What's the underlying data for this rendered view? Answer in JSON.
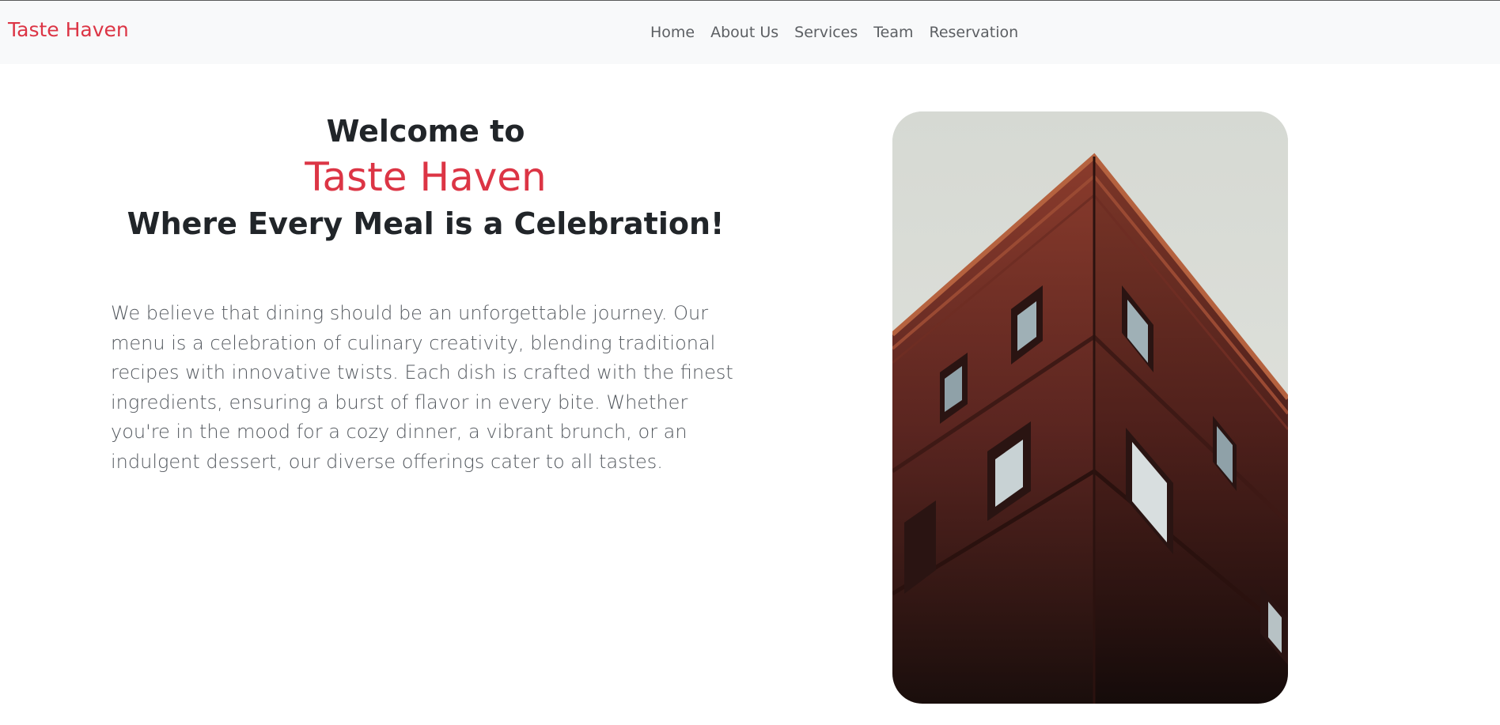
{
  "nav": {
    "brand": "Taste Haven",
    "links": [
      "Home",
      "About Us",
      "Services",
      "Team",
      "Reservation"
    ]
  },
  "hero": {
    "welcome": "Welcome to",
    "brand": "Taste Haven",
    "tagline": "Where Every Meal is a Celebration!",
    "description": "We believe that dining should be an unforgettable journey. Our menu is a celebration of culinary creativity, blending traditional recipes with innovative twists. Each dish is crafted with the finest ingredients, ensuring a burst of flavor in every bite. Whether you're in the mood for a cozy dinner, a vibrant brunch, or an indulgent dessert, our diverse offerings cater to all tastes."
  },
  "colors": {
    "accent": "#dc3545",
    "navbar_bg": "#f8f9fa",
    "text_dark": "#212529",
    "text_muted": "#555a60"
  },
  "image": {
    "subject": "building-corner-photo"
  }
}
